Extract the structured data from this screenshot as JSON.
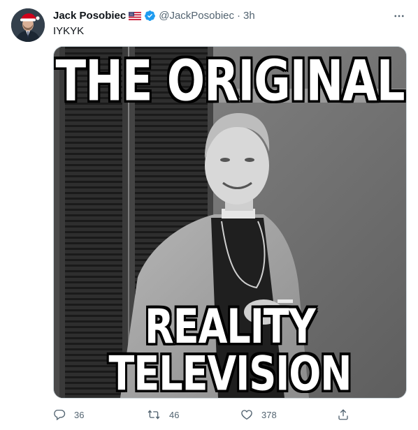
{
  "tweet": {
    "author": {
      "display_name": "Jack Posobiec",
      "handle": "@JackPosobiec",
      "flag_icon": "us-flag-icon",
      "verified_icon": "verified-badge-icon",
      "verified_color": "#1d9bf0"
    },
    "separator": "·",
    "time": "3h",
    "text": "IYKYK",
    "media": {
      "caption_top": "THE ORIGINAL",
      "caption_bottom": "REALITY TELEVISION"
    },
    "actions": {
      "replies": "36",
      "retweets": "46",
      "likes": "378"
    }
  }
}
